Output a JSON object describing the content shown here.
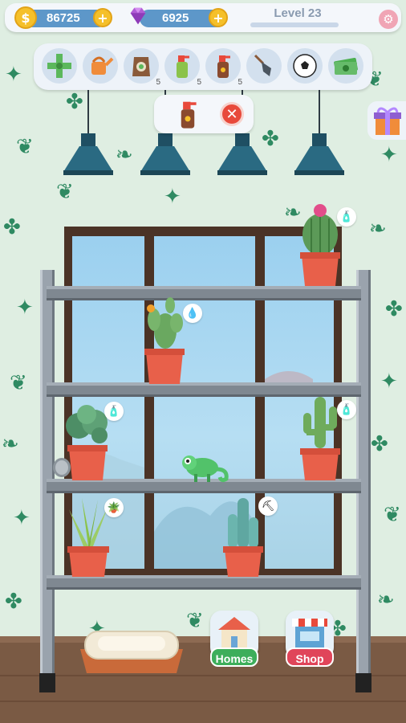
{
  "hud": {
    "coins": "86725",
    "gems": "6925",
    "level": "Level 23",
    "level_progress": 0.0,
    "icons": {
      "coin": "coin-icon",
      "gem": "gem-icon",
      "add": "plus-icon",
      "settings": "gear-icon"
    }
  },
  "toolbar": {
    "tools": [
      {
        "name": "fertilizer-cross-icon",
        "count": ""
      },
      {
        "name": "watering-can-icon",
        "count": ""
      },
      {
        "name": "soil-bag-icon",
        "count": "5"
      },
      {
        "name": "spray-bottle-icon",
        "count": "5"
      },
      {
        "name": "pesticide-spray-icon",
        "count": "5"
      },
      {
        "name": "shovel-icon",
        "count": ""
      },
      {
        "name": "soccer-ball-icon",
        "count": ""
      },
      {
        "name": "cash-icon",
        "count": ""
      }
    ]
  },
  "popup": {
    "selected_tool": "pesticide-spray-icon",
    "close_icon": "close-icon"
  },
  "gift": {
    "icon": "gift-icon"
  },
  "plants": [
    {
      "name": "round-cactus",
      "shelf": 1,
      "badge": "pesticide-spray-icon"
    },
    {
      "name": "flowering-prickly-pear",
      "shelf": 2,
      "badge": "water-drop-icon"
    },
    {
      "name": "leafy-plant",
      "shelf": 3,
      "badge": "pesticide-spray-icon"
    },
    {
      "name": "saguaro-cactus",
      "shelf": 3,
      "badge": "pesticide-spray-icon"
    },
    {
      "name": "aloe-plant",
      "shelf": 4,
      "badge": "soil-bag-icon"
    },
    {
      "name": "column-cactus",
      "shelf": 4,
      "badge": "shovel-icon"
    }
  ],
  "pet": {
    "name": "chameleon"
  },
  "nav": {
    "homes_label": "Homes",
    "shop_label": "Shop"
  },
  "colors": {
    "wallpaper": "#dfeee2",
    "leaf": "#2f8a62",
    "pill": "#5d97c9",
    "homes": "#3dae5b",
    "shop": "#e0455a"
  }
}
